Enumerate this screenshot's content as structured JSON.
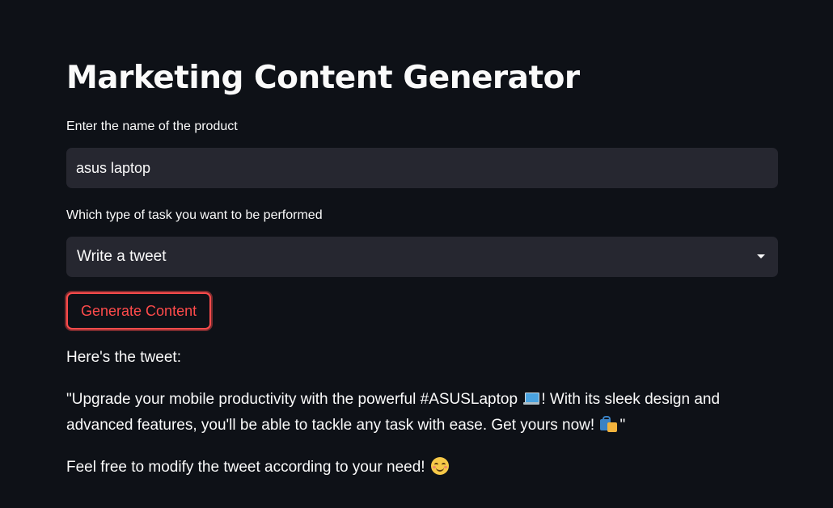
{
  "page": {
    "title": "Marketing Content Generator"
  },
  "form": {
    "product_label": "Enter the name of the product",
    "product_value": "asus laptop",
    "task_label": "Which type of task you want to be performed",
    "task_selected": "Write a tweet",
    "generate_label": "Generate Content"
  },
  "output": {
    "intro": "Here's the tweet:",
    "tweet_part1": "\"Upgrade your mobile productivity with the powerful #ASUSLaptop",
    "tweet_part2": "! With its sleek design and advanced features, you'll be able to tackle any task with ease. Get yours now!",
    "tweet_part3": "\"",
    "closing": "Feel free to modify the tweet according to your need!"
  },
  "icons": {
    "laptop": "laptop-emoji",
    "shopping": "shopping-bags-emoji",
    "smile": "smiling-face-emoji",
    "dropdown": "chevron-down-icon"
  },
  "colors": {
    "background": "#0e1117",
    "input_bg": "#262730",
    "accent": "#ff4b4b",
    "text": "#fafafa"
  }
}
